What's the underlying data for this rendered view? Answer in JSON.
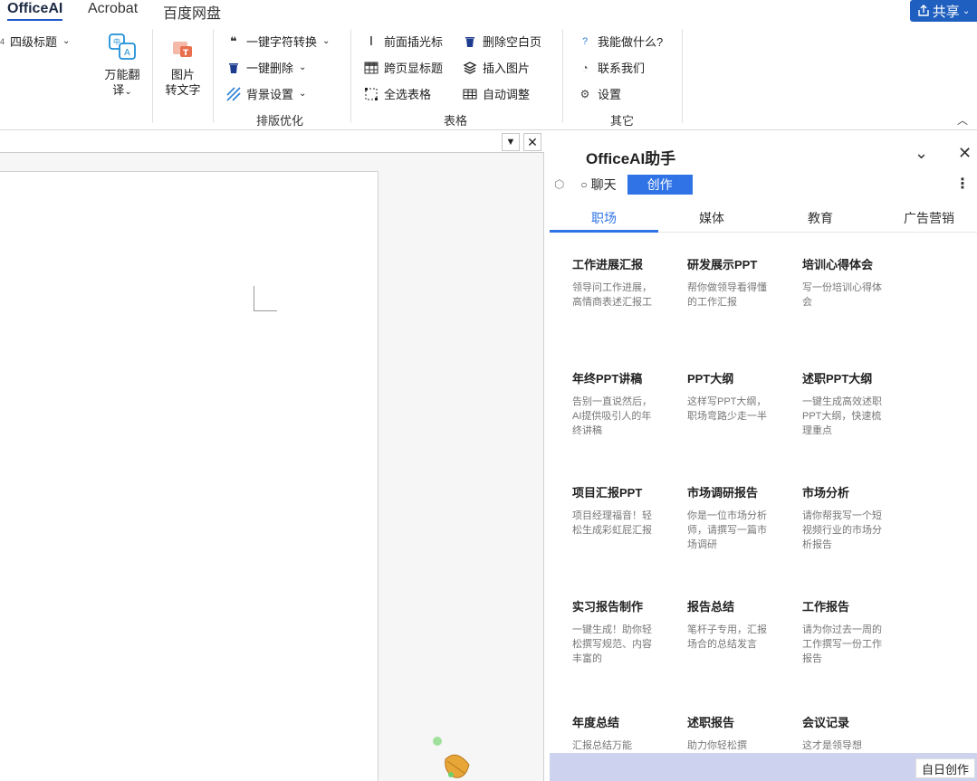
{
  "tabs": [
    "OfficeAI",
    "Acrobat",
    "百度网盘"
  ],
  "share_label": "共享",
  "ribbon": {
    "heading_dropdown": "四级标题",
    "translate_label_1": "万能翻",
    "translate_label_2": "译",
    "image_to_text_1": "图片",
    "image_to_text_2": "转文字",
    "layout": {
      "items": [
        "一键字符转换",
        "一键删除",
        "背景设置"
      ],
      "group_label": "排版优化"
    },
    "table": {
      "items": [
        "前面插光标",
        "删除空白页",
        "跨页显标题",
        "插入图片",
        "全选表格",
        "自动调整"
      ],
      "group_label": "表格"
    },
    "other": {
      "items": [
        "我能做什么?",
        "联系我们",
        "设置"
      ],
      "group_label": "其它"
    }
  },
  "panel": {
    "title": "OfficeAI助手",
    "mode_chat": "聊天",
    "mode_create": "创作",
    "categories": [
      "职场",
      "媒体",
      "教育",
      "广告营销"
    ],
    "cards": [
      {
        "title": "工作进展汇报",
        "desc": "领导问工作进展，高情商表述汇报工作"
      },
      {
        "title": "研发展示PPT",
        "desc": "帮你做领导看得懂的工作汇报"
      },
      {
        "title": "培训心得体会",
        "desc": "写一份培训心得体会"
      },
      {
        "title": "年终PPT讲稿",
        "desc": "告别一直说然后，AI提供吸引人的年终讲稿"
      },
      {
        "title": "PPT大纲",
        "desc": "这样写PPT大纲，职场弯路少走一半"
      },
      {
        "title": "述职PPT大纲",
        "desc": "一键生成高效述职PPT大纲，快速梳理重点"
      },
      {
        "title": "项目汇报PPT",
        "desc": "项目经理福音！轻松生成彩虹屁汇报"
      },
      {
        "title": "市场调研报告",
        "desc": "你是一位市场分析师，请撰写一篇市场调研"
      },
      {
        "title": "市场分析",
        "desc": "请你帮我写一个短视频行业的市场分析报告"
      },
      {
        "title": "实习报告制作",
        "desc": "一键生成！助你轻松撰写规范、内容丰富的"
      },
      {
        "title": "报告总结",
        "desc": "笔杆子专用，汇报场合的总结发言"
      },
      {
        "title": "工作报告",
        "desc": "请为你过去一周的工作撰写一份工作报告"
      },
      {
        "title": "年度总结",
        "desc": "汇报总结万能"
      },
      {
        "title": "述职报告",
        "desc": "助力你轻松撰"
      },
      {
        "title": "会议记录",
        "desc": "这才是领导想"
      }
    ],
    "daily_button": "自日创作"
  },
  "colors": {
    "accent": "#2f73e6",
    "share": "#1f5fbf",
    "footer": "#cdd3ee"
  }
}
